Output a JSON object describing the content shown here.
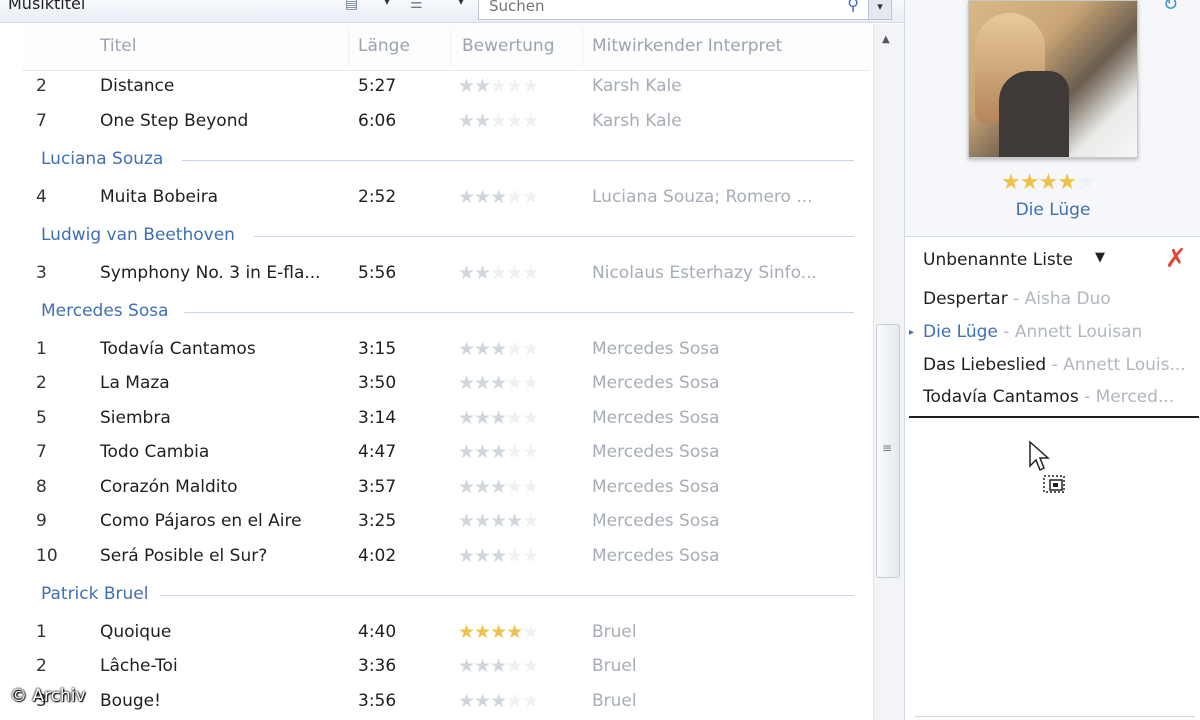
{
  "toolbar": {
    "breadcrumb": "Musiktitel",
    "search_placeholder": "Suchen"
  },
  "columns": {
    "title": "Titel",
    "length": "Länge",
    "rating": "Bewertung",
    "artist": "Mitwirkender Interpret"
  },
  "tracks": [
    {
      "num": "2",
      "title": "Distance",
      "length": "5:27",
      "rating": 2,
      "artist": "Karsh Kale"
    },
    {
      "num": "7",
      "title": "One Step Beyond",
      "length": "6:06",
      "rating": 2,
      "artist": "Karsh Kale"
    },
    {
      "num": "4",
      "title": "Muita Bobeira",
      "length": "2:52",
      "rating": 3,
      "artist": "Luciana Souza; Romero ..."
    },
    {
      "num": "3",
      "title": "Symphony No. 3 in E-fla...",
      "length": "5:56",
      "rating": 2,
      "artist": "Nicolaus Esterhazy Sinfo..."
    },
    {
      "num": "1",
      "title": "Todavía Cantamos",
      "length": "3:15",
      "rating": 3,
      "artist": "Mercedes Sosa"
    },
    {
      "num": "2",
      "title": "La Maza",
      "length": "3:50",
      "rating": 3,
      "artist": "Mercedes Sosa"
    },
    {
      "num": "5",
      "title": "Siembra",
      "length": "3:14",
      "rating": 3,
      "artist": "Mercedes Sosa"
    },
    {
      "num": "7",
      "title": "Todo Cambia",
      "length": "4:47",
      "rating": 3,
      "artist": "Mercedes Sosa"
    },
    {
      "num": "8",
      "title": "Corazón Maldito",
      "length": "3:57",
      "rating": 3,
      "artist": "Mercedes Sosa"
    },
    {
      "num": "9",
      "title": "Como Pájaros en el Aire",
      "length": "3:25",
      "rating": 4,
      "artist": "Mercedes Sosa"
    },
    {
      "num": "10",
      "title": "Será Posible el Sur?",
      "length": "4:02",
      "rating": 3,
      "artist": "Mercedes Sosa"
    },
    {
      "num": "1",
      "title": "Quoique",
      "length": "4:40",
      "rating": 4,
      "artist": "Bruel"
    },
    {
      "num": "2",
      "title": "Lâche-Toi",
      "length": "3:36",
      "rating": 3,
      "artist": "Bruel"
    },
    {
      "num": "3",
      "title": "Bouge!",
      "length": "3:56",
      "rating": 3,
      "artist": "Bruel"
    }
  ],
  "groups": [
    "Luciana Souza",
    "Ludwig van Beethoven",
    "Mercedes Sosa",
    "Patrick Bruel"
  ],
  "now_playing": {
    "title": "Die Lüge",
    "rating": 4
  },
  "playlist": {
    "name": "Unbenannte Liste",
    "items": [
      {
        "title": "Despertar",
        "artist": " - Aisha Duo"
      },
      {
        "title": "Die Lüge",
        "artist": " - Annett Louisan"
      },
      {
        "title": "Das Liebeslied",
        "artist": " - Annett Louis..."
      },
      {
        "title": "Todavía Cantamos",
        "artist": " - Merced..."
      }
    ]
  },
  "copyright": "© Archiv",
  "colors": {
    "group_header": "#3f6fb5",
    "gold_star": "#efc24a",
    "close_red": "#e04a3a"
  }
}
